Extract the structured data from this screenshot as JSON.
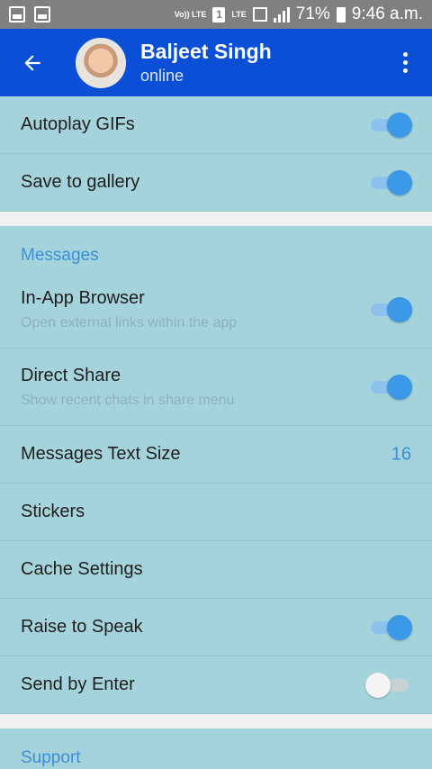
{
  "status_bar": {
    "volte_label": "Vo)) LTE",
    "sim_label": "1",
    "lte_label": "LTE",
    "battery_percent": "71%",
    "time": "9:46 a.m."
  },
  "app_bar": {
    "contact_name": "Baljeet Singh",
    "contact_status": "online"
  },
  "settings": {
    "autoplay_gifs": {
      "title": "Autoplay GIFs",
      "enabled": true
    },
    "save_to_gallery": {
      "title": "Save to gallery",
      "enabled": true
    },
    "messages_header": "Messages",
    "in_app_browser": {
      "title": "In-App Browser",
      "subtitle": "Open external links within the app",
      "enabled": true
    },
    "direct_share": {
      "title": "Direct Share",
      "subtitle": "Show recent chats in share menu",
      "enabled": true
    },
    "messages_text_size": {
      "title": "Messages Text Size",
      "value": "16"
    },
    "stickers": {
      "title": "Stickers"
    },
    "cache_settings": {
      "title": "Cache Settings"
    },
    "raise_to_speak": {
      "title": "Raise to Speak",
      "enabled": true
    },
    "send_by_enter": {
      "title": "Send by Enter",
      "enabled": false
    },
    "support_header": "Support"
  },
  "colors": {
    "app_bar": "#0a4fd6",
    "background": "#a5d3dc",
    "accent": "#3b8fd8",
    "status_bar": "#808080"
  }
}
